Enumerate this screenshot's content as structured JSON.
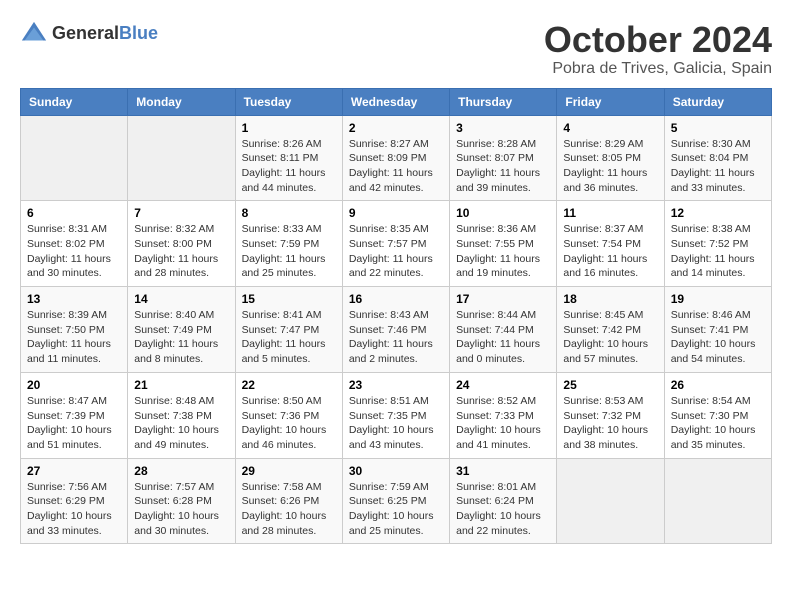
{
  "logo": {
    "general": "General",
    "blue": "Blue"
  },
  "title": "October 2024",
  "subtitle": "Pobra de Trives, Galicia, Spain",
  "days_of_week": [
    "Sunday",
    "Monday",
    "Tuesday",
    "Wednesday",
    "Thursday",
    "Friday",
    "Saturday"
  ],
  "weeks": [
    [
      {
        "num": "",
        "sunrise": "",
        "sunset": "",
        "daylight": ""
      },
      {
        "num": "",
        "sunrise": "",
        "sunset": "",
        "daylight": ""
      },
      {
        "num": "1",
        "sunrise": "Sunrise: 8:26 AM",
        "sunset": "Sunset: 8:11 PM",
        "daylight": "Daylight: 11 hours and 44 minutes."
      },
      {
        "num": "2",
        "sunrise": "Sunrise: 8:27 AM",
        "sunset": "Sunset: 8:09 PM",
        "daylight": "Daylight: 11 hours and 42 minutes."
      },
      {
        "num": "3",
        "sunrise": "Sunrise: 8:28 AM",
        "sunset": "Sunset: 8:07 PM",
        "daylight": "Daylight: 11 hours and 39 minutes."
      },
      {
        "num": "4",
        "sunrise": "Sunrise: 8:29 AM",
        "sunset": "Sunset: 8:05 PM",
        "daylight": "Daylight: 11 hours and 36 minutes."
      },
      {
        "num": "5",
        "sunrise": "Sunrise: 8:30 AM",
        "sunset": "Sunset: 8:04 PM",
        "daylight": "Daylight: 11 hours and 33 minutes."
      }
    ],
    [
      {
        "num": "6",
        "sunrise": "Sunrise: 8:31 AM",
        "sunset": "Sunset: 8:02 PM",
        "daylight": "Daylight: 11 hours and 30 minutes."
      },
      {
        "num": "7",
        "sunrise": "Sunrise: 8:32 AM",
        "sunset": "Sunset: 8:00 PM",
        "daylight": "Daylight: 11 hours and 28 minutes."
      },
      {
        "num": "8",
        "sunrise": "Sunrise: 8:33 AM",
        "sunset": "Sunset: 7:59 PM",
        "daylight": "Daylight: 11 hours and 25 minutes."
      },
      {
        "num": "9",
        "sunrise": "Sunrise: 8:35 AM",
        "sunset": "Sunset: 7:57 PM",
        "daylight": "Daylight: 11 hours and 22 minutes."
      },
      {
        "num": "10",
        "sunrise": "Sunrise: 8:36 AM",
        "sunset": "Sunset: 7:55 PM",
        "daylight": "Daylight: 11 hours and 19 minutes."
      },
      {
        "num": "11",
        "sunrise": "Sunrise: 8:37 AM",
        "sunset": "Sunset: 7:54 PM",
        "daylight": "Daylight: 11 hours and 16 minutes."
      },
      {
        "num": "12",
        "sunrise": "Sunrise: 8:38 AM",
        "sunset": "Sunset: 7:52 PM",
        "daylight": "Daylight: 11 hours and 14 minutes."
      }
    ],
    [
      {
        "num": "13",
        "sunrise": "Sunrise: 8:39 AM",
        "sunset": "Sunset: 7:50 PM",
        "daylight": "Daylight: 11 hours and 11 minutes."
      },
      {
        "num": "14",
        "sunrise": "Sunrise: 8:40 AM",
        "sunset": "Sunset: 7:49 PM",
        "daylight": "Daylight: 11 hours and 8 minutes."
      },
      {
        "num": "15",
        "sunrise": "Sunrise: 8:41 AM",
        "sunset": "Sunset: 7:47 PM",
        "daylight": "Daylight: 11 hours and 5 minutes."
      },
      {
        "num": "16",
        "sunrise": "Sunrise: 8:43 AM",
        "sunset": "Sunset: 7:46 PM",
        "daylight": "Daylight: 11 hours and 2 minutes."
      },
      {
        "num": "17",
        "sunrise": "Sunrise: 8:44 AM",
        "sunset": "Sunset: 7:44 PM",
        "daylight": "Daylight: 11 hours and 0 minutes."
      },
      {
        "num": "18",
        "sunrise": "Sunrise: 8:45 AM",
        "sunset": "Sunset: 7:42 PM",
        "daylight": "Daylight: 10 hours and 57 minutes."
      },
      {
        "num": "19",
        "sunrise": "Sunrise: 8:46 AM",
        "sunset": "Sunset: 7:41 PM",
        "daylight": "Daylight: 10 hours and 54 minutes."
      }
    ],
    [
      {
        "num": "20",
        "sunrise": "Sunrise: 8:47 AM",
        "sunset": "Sunset: 7:39 PM",
        "daylight": "Daylight: 10 hours and 51 minutes."
      },
      {
        "num": "21",
        "sunrise": "Sunrise: 8:48 AM",
        "sunset": "Sunset: 7:38 PM",
        "daylight": "Daylight: 10 hours and 49 minutes."
      },
      {
        "num": "22",
        "sunrise": "Sunrise: 8:50 AM",
        "sunset": "Sunset: 7:36 PM",
        "daylight": "Daylight: 10 hours and 46 minutes."
      },
      {
        "num": "23",
        "sunrise": "Sunrise: 8:51 AM",
        "sunset": "Sunset: 7:35 PM",
        "daylight": "Daylight: 10 hours and 43 minutes."
      },
      {
        "num": "24",
        "sunrise": "Sunrise: 8:52 AM",
        "sunset": "Sunset: 7:33 PM",
        "daylight": "Daylight: 10 hours and 41 minutes."
      },
      {
        "num": "25",
        "sunrise": "Sunrise: 8:53 AM",
        "sunset": "Sunset: 7:32 PM",
        "daylight": "Daylight: 10 hours and 38 minutes."
      },
      {
        "num": "26",
        "sunrise": "Sunrise: 8:54 AM",
        "sunset": "Sunset: 7:30 PM",
        "daylight": "Daylight: 10 hours and 35 minutes."
      }
    ],
    [
      {
        "num": "27",
        "sunrise": "Sunrise: 7:56 AM",
        "sunset": "Sunset: 6:29 PM",
        "daylight": "Daylight: 10 hours and 33 minutes."
      },
      {
        "num": "28",
        "sunrise": "Sunrise: 7:57 AM",
        "sunset": "Sunset: 6:28 PM",
        "daylight": "Daylight: 10 hours and 30 minutes."
      },
      {
        "num": "29",
        "sunrise": "Sunrise: 7:58 AM",
        "sunset": "Sunset: 6:26 PM",
        "daylight": "Daylight: 10 hours and 28 minutes."
      },
      {
        "num": "30",
        "sunrise": "Sunrise: 7:59 AM",
        "sunset": "Sunset: 6:25 PM",
        "daylight": "Daylight: 10 hours and 25 minutes."
      },
      {
        "num": "31",
        "sunrise": "Sunrise: 8:01 AM",
        "sunset": "Sunset: 6:24 PM",
        "daylight": "Daylight: 10 hours and 22 minutes."
      },
      {
        "num": "",
        "sunrise": "",
        "sunset": "",
        "daylight": ""
      },
      {
        "num": "",
        "sunrise": "",
        "sunset": "",
        "daylight": ""
      }
    ]
  ]
}
